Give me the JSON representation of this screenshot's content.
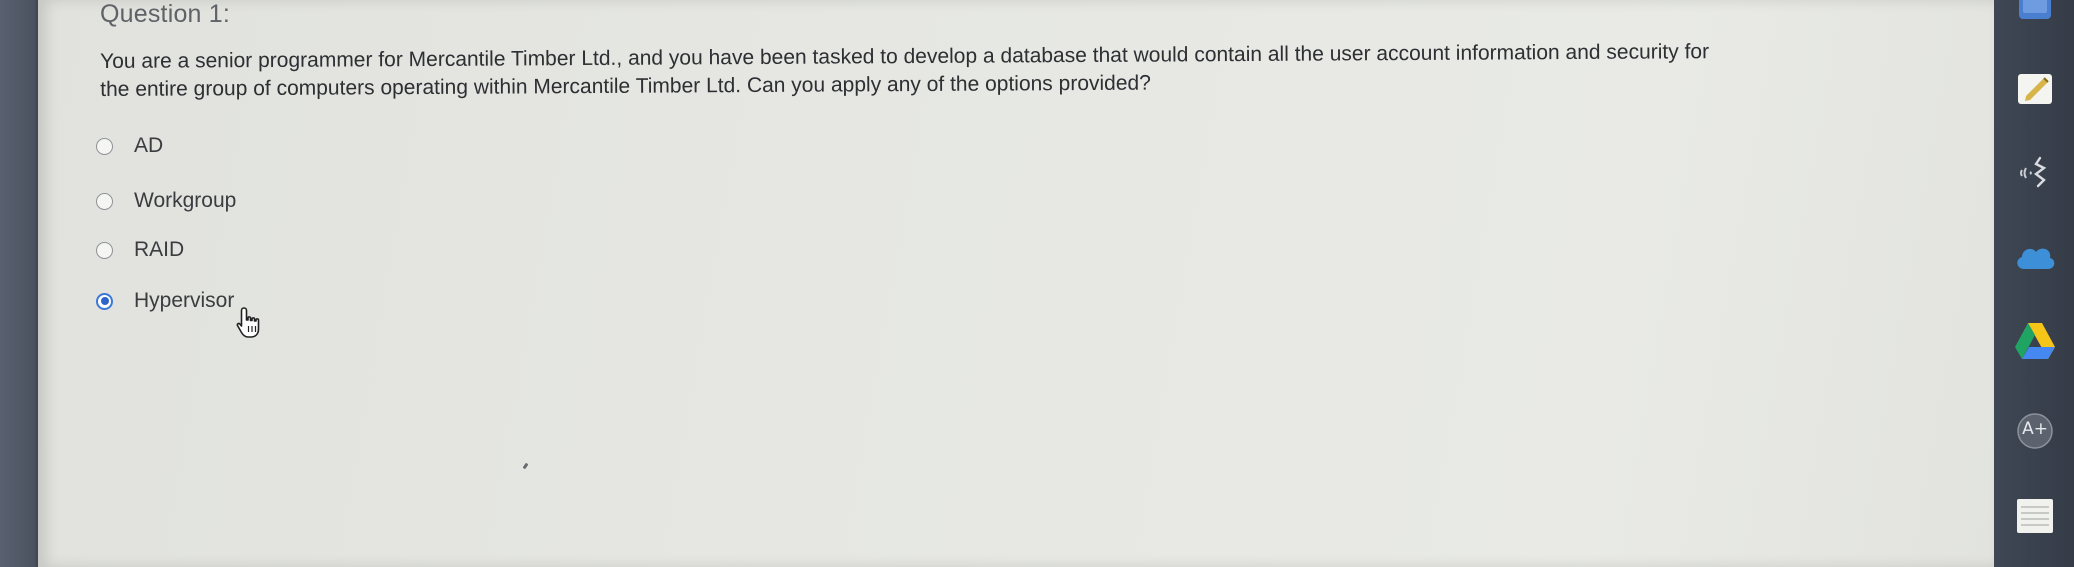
{
  "question": {
    "title": "Question 1:",
    "text_line1": "You are a senior programmer for Mercantile Timber Ltd., and you have been tasked to develop a database that would contain all the user account information and security for",
    "text_line2": "the entire group of computers operating within Mercantile Timber Ltd. Can you apply any of the options provided?"
  },
  "options": [
    {
      "label": "AD",
      "selected": false
    },
    {
      "label": "Workgroup",
      "selected": false
    },
    {
      "label": "RAID",
      "selected": false
    },
    {
      "label": "Hypervisor",
      "selected": true
    }
  ],
  "sidebar": {
    "icons": [
      "app-icon",
      "notes-icon",
      "audio-wave-icon",
      "cloud-icon",
      "google-drive-icon",
      "text-size-icon",
      "document-icon"
    ],
    "text_size_label": "A+"
  },
  "colors": {
    "accent": "#2d66c8",
    "panel": "#e6e7e3",
    "sidebar": "#3a414e"
  }
}
